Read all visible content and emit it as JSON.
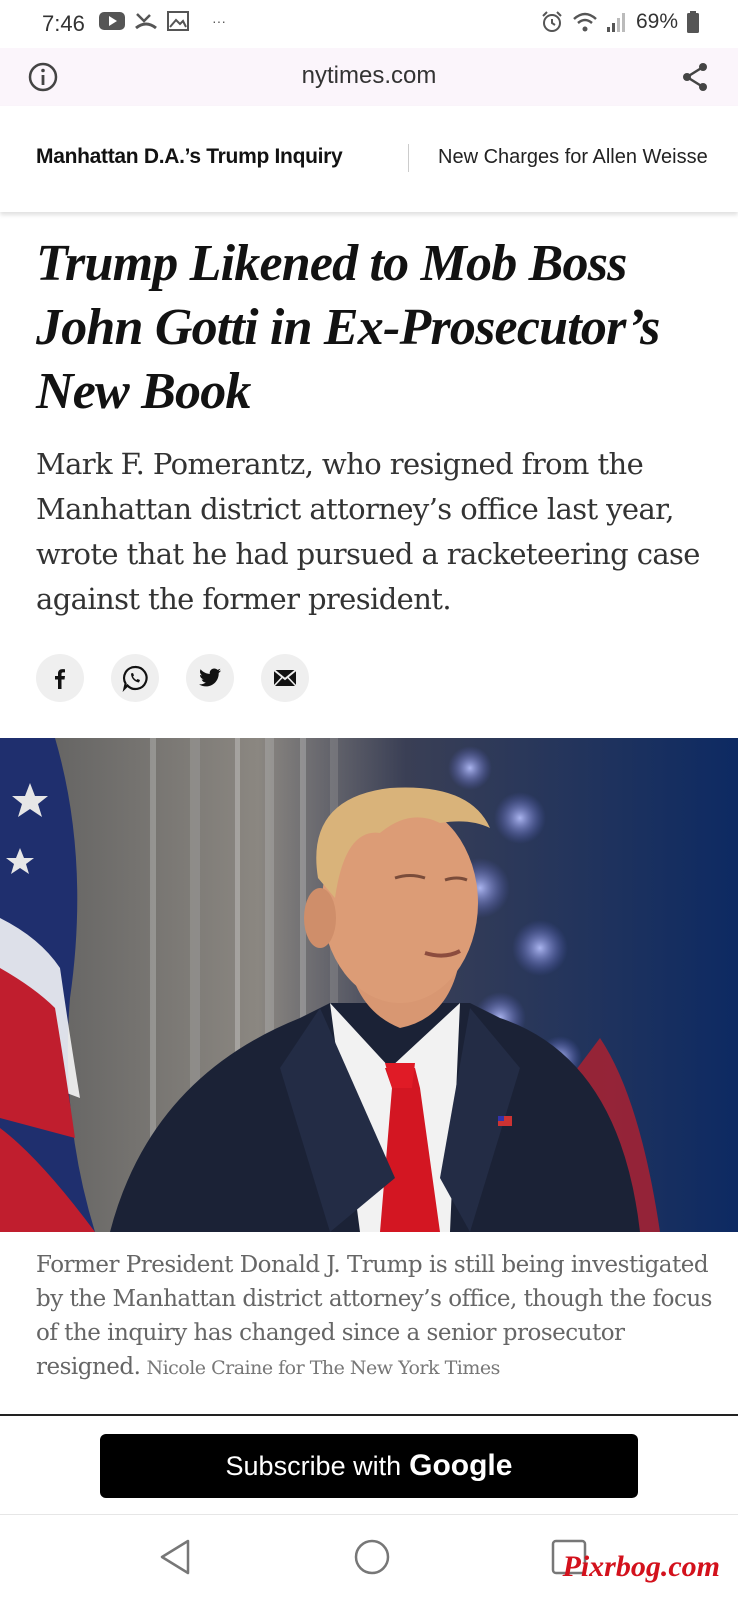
{
  "status_bar": {
    "time": "7:46",
    "battery": "69%",
    "more": "···"
  },
  "address_bar": {
    "url": "nytimes.com"
  },
  "topics": [
    "Manhattan D.A.’s Trump Inquiry",
    "New Charges for Allen Weisse"
  ],
  "article": {
    "headline": "Trump Likened to Mob Boss John Gotti in Ex-Prosecutor’s New Book",
    "summary": "Mark F. Pomerantz, who resigned from the Manhattan district attorney’s office last year, wrote that he had pursued a racketeering case against the former president.",
    "share_icons": [
      "facebook-icon",
      "whatsapp-icon",
      "twitter-icon",
      "email-icon"
    ],
    "caption": "Former President Donald J. Trump is still being investigated by the Manhattan district attorney’s office, though the focus of the inquiry has changed since a senior prosecutor resigned.",
    "credit": "Nicole Craine for The New York Times"
  },
  "subscribe": {
    "label": "Subscribe with",
    "brand": "Google"
  },
  "watermark": "Pixrbog.com"
}
